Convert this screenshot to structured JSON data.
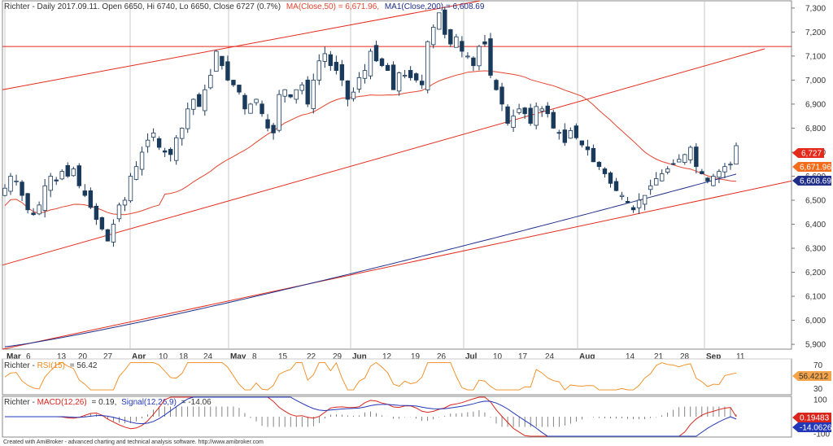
{
  "main": {
    "symbol": "Richter",
    "header_main": "Richter - Daily 2017.09.11. Open 6650, Hi 6740, Lo 6650, Close 6727 (0.7%)",
    "header_ma50": "MA(Close,50) = 6,671.96,",
    "header_ma200": "MA1(Close,200) = 6,608.69",
    "y_ticks": [
      "7,300",
      "7,200",
      "7,100",
      "7,000",
      "6,900",
      "6,800",
      "6,700",
      "6,600",
      "6,500",
      "6,400",
      "6,300",
      "6,200",
      "6,100",
      "6,000",
      "5,900"
    ],
    "x_ticks": [
      "Mar",
      "6",
      "13",
      "20",
      "27",
      "Apr",
      "10",
      "18",
      "24",
      "May",
      "8",
      "15",
      "22",
      "29",
      "Jun",
      "12",
      "19",
      "26",
      "Jul",
      "10",
      "17",
      "24",
      "Aug",
      "14",
      "21",
      "28",
      "Sep",
      "11"
    ],
    "badges": {
      "close": "6,727",
      "ma50": "6,671.96",
      "ma200": "6,608.69"
    },
    "colors": {
      "up": "#ffffff",
      "down": "#1a3a5c",
      "ma50": "#e4452f",
      "ma200": "#1f2f8a",
      "trend": "#e42a1b"
    }
  },
  "rsi": {
    "label_prefix": "Richter - ",
    "label_name": "RSI(15)",
    "label_value": "= 56.42",
    "badge": "56.4212",
    "ticks": [
      "70",
      "50",
      "30"
    ],
    "color": "#f08a1c"
  },
  "macd": {
    "label_prefix": "Richter - ",
    "label_macd": "MACD(12,26)",
    "label_mid": "= 0.19,",
    "label_signal": "Signal(12,26,9)",
    "label_end": "= -14.06",
    "badge_macd": "0.19483",
    "badge_signal": "-14.0626",
    "ticks": [
      "100",
      "0",
      "-100"
    ],
    "macd_color": "#d9251c",
    "signal_color": "#2338b8"
  },
  "footer": "Created with AmiBroker - advanced charting and technical analysis software. http://www.amibroker.com",
  "chart_data": [
    {
      "type": "candlestick",
      "title": "Richter - Daily 2017.09.11. Open 6650, Hi 6740, Lo 6650, Close 6727 (0.7%)",
      "ylim": [
        5880,
        7330
      ],
      "last_bar": {
        "date": "2017.09.11",
        "open": 6650,
        "high": 6740,
        "low": 6650,
        "close": 6727
      },
      "series": [
        {
          "name": "MA(Close,50)",
          "last": 6671.96
        },
        {
          "name": "MA1(Close,200)",
          "last": 6608.69
        }
      ],
      "approx_closes": [
        6550,
        6600,
        6580,
        6520,
        6460,
        6440,
        6480,
        6560,
        6600,
        6580,
        6620,
        6600,
        6630,
        6560,
        6520,
        6470,
        6420,
        6380,
        6330,
        6400,
        6480,
        6500,
        6600,
        6640,
        6700,
        6750,
        6780,
        6720,
        6700,
        6690,
        6760,
        6800,
        6880,
        6920,
        6890,
        6960,
        7020,
        7120,
        7060,
        7000,
        6980,
        6950,
        6880,
        6900,
        6920,
        6860,
        6800,
        6780,
        6940,
        6960,
        6930,
        6960,
        6980,
        6900,
        7000,
        7080,
        7110,
        7060,
        7040,
        7000,
        6920,
        6950,
        7010,
        7040,
        7120,
        7080,
        7060,
        7040,
        6960,
        7030,
        7020,
        7010,
        7000,
        6980,
        7160,
        7220,
        7280,
        7190,
        7150,
        7180,
        7120,
        7100,
        7060,
        7140,
        7150,
        7020,
        6960,
        6900,
        6820,
        6850,
        6880,
        6860,
        6820,
        6890,
        6880,
        6860,
        6800,
        6780,
        6740,
        6790,
        6760,
        6730,
        6710,
        6660,
        6640,
        6610,
        6570,
        6540,
        6520,
        6490,
        6460,
        6500,
        6520,
        6560,
        6590,
        6610,
        6630,
        6650,
        6670,
        6690,
        6720,
        6640,
        6610,
        6580,
        6600,
        6620,
        6640,
        6650,
        6727
      ]
    },
    {
      "type": "line",
      "title": "RSI(15)",
      "ylim": [
        20,
        80
      ],
      "series": [
        {
          "name": "RSI(15)",
          "last": 56.42
        }
      ]
    },
    {
      "type": "line",
      "title": "MACD(12,26)",
      "ylim": [
        -120,
        120
      ],
      "series": [
        {
          "name": "MACD(12,26)",
          "last": 0.19
        },
        {
          "name": "Signal(12,26,9)",
          "last": -14.06
        }
      ]
    }
  ]
}
